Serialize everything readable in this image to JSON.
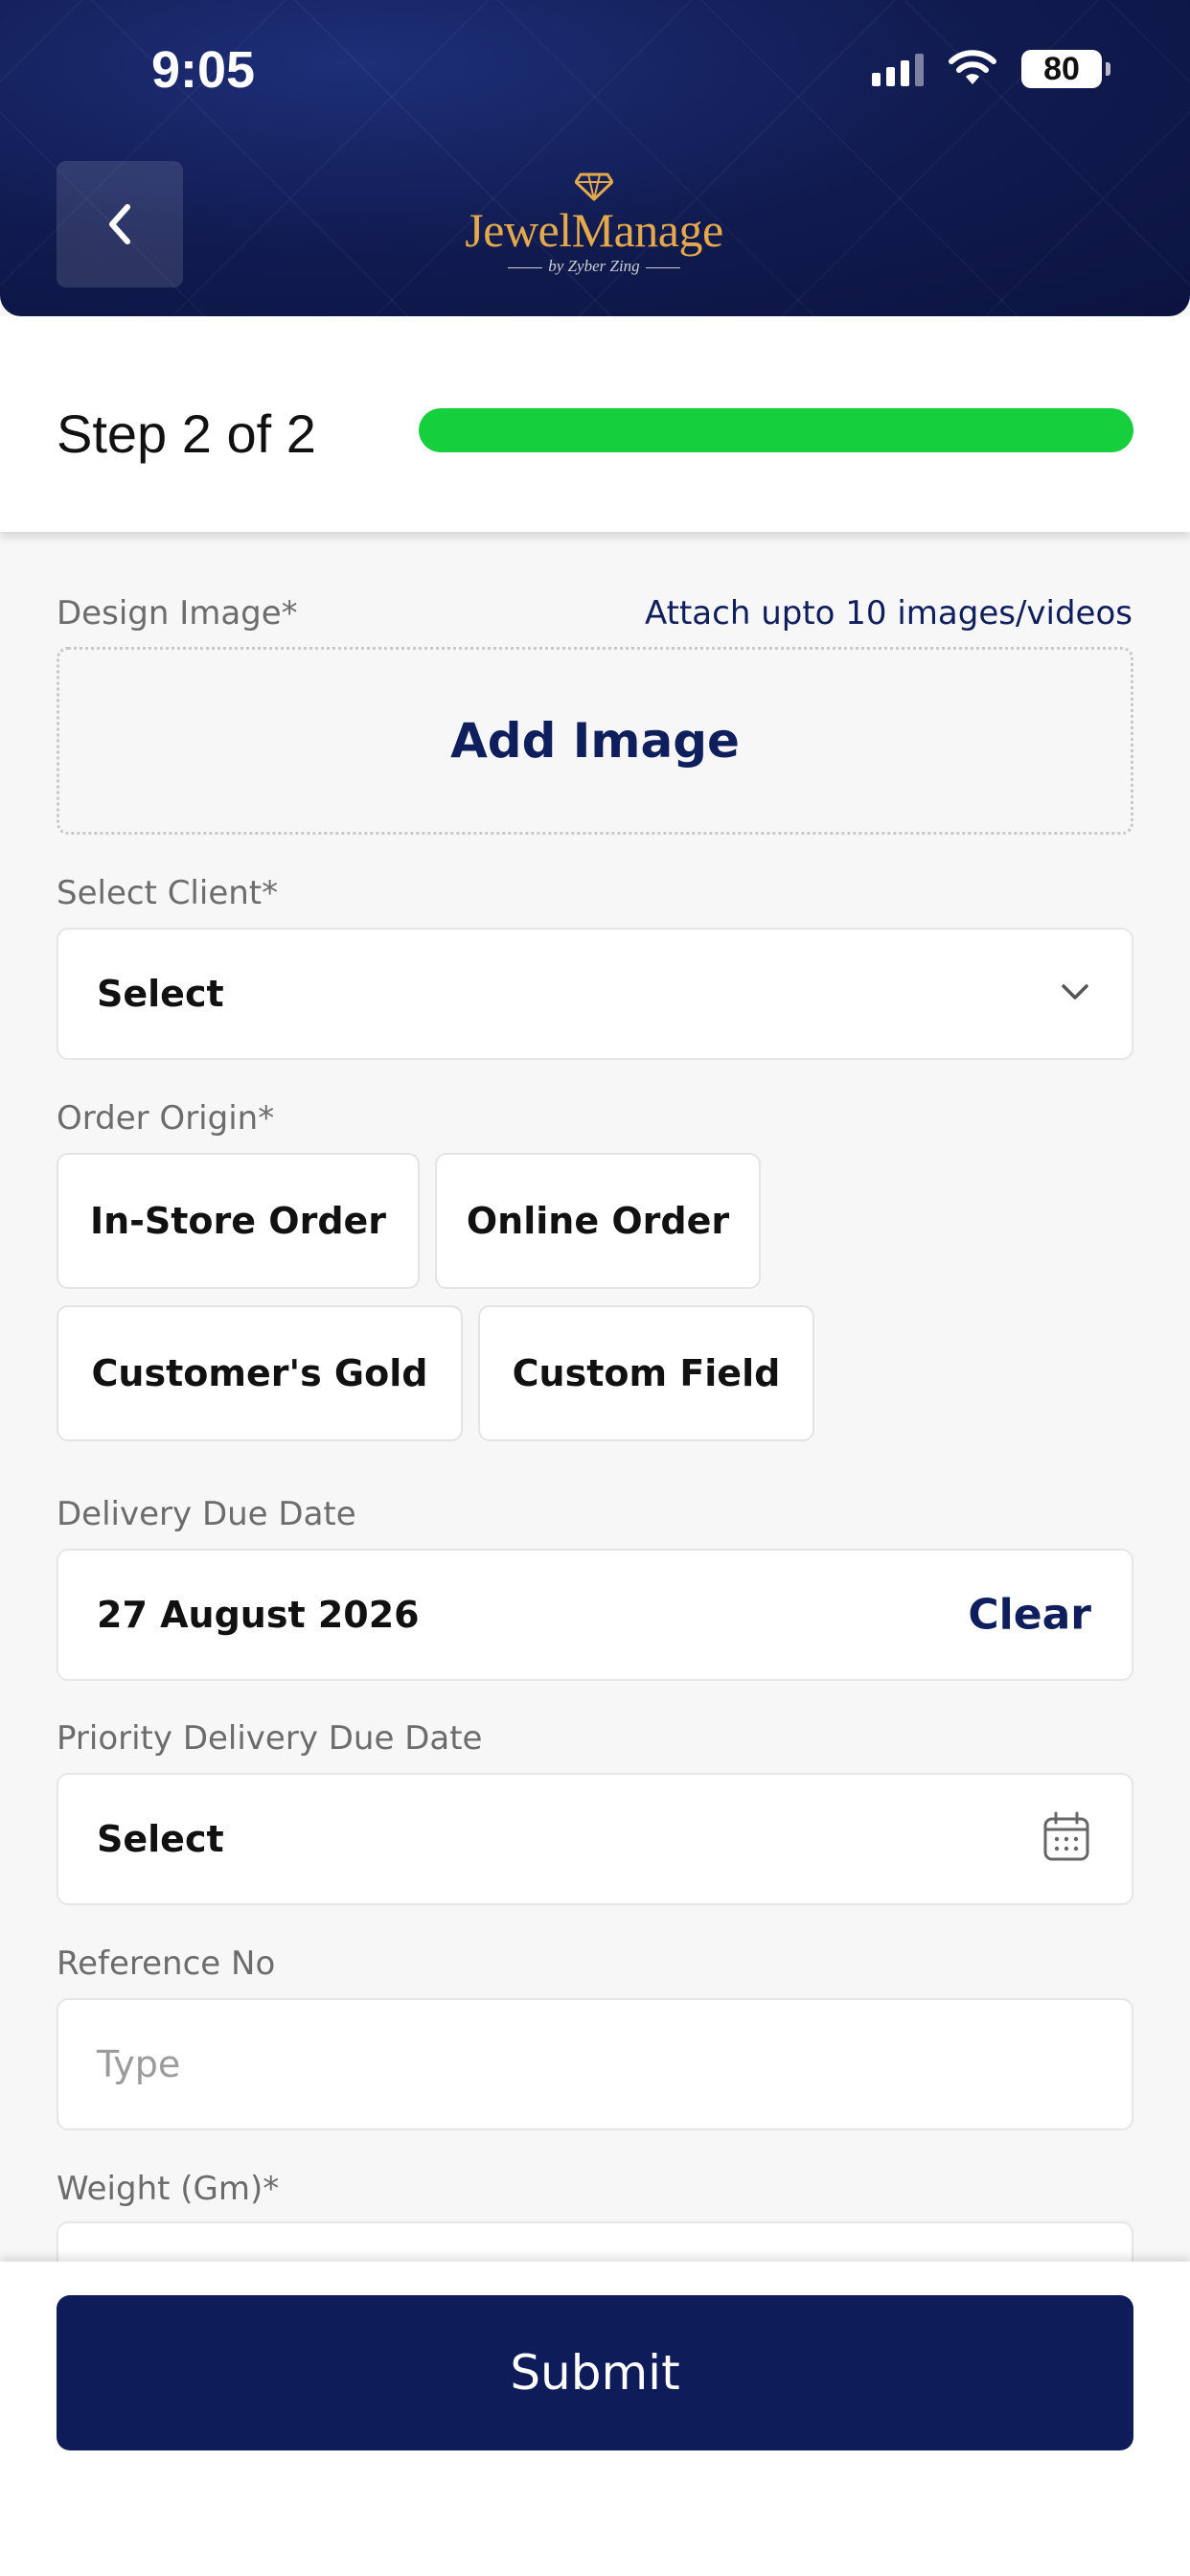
{
  "status_bar": {
    "time": "9:05",
    "battery": "80"
  },
  "header": {
    "logo_main": "JewelManage",
    "logo_sub": "by Zyber Zing"
  },
  "step": {
    "label": "Step 2 of 2",
    "progress": 1.0
  },
  "form": {
    "design_image": {
      "label": "Design Image*",
      "hint": "Attach upto 10 images/videos",
      "button": "Add Image"
    },
    "client": {
      "label": "Select Client*",
      "value": "Select"
    },
    "order_origin": {
      "label": "Order Origin*",
      "options": [
        "In-Store Order",
        "Online Order",
        "Customer's Gold",
        "Custom Field"
      ]
    },
    "delivery_due_date": {
      "label": "Delivery Due Date",
      "value": "27 August 2026",
      "clear": "Clear"
    },
    "priority_delivery_due_date": {
      "label": "Priority Delivery Due Date",
      "value": "Select"
    },
    "reference_no": {
      "label": "Reference No",
      "placeholder": "Type"
    },
    "weight": {
      "label": "Weight (Gm)*"
    }
  },
  "footer": {
    "submit": "Submit"
  },
  "colors": {
    "navy": "#0f1c5a",
    "progress": "#15cf3c",
    "gold": "#e3a94a"
  },
  "icons": [
    "signal-icon",
    "wifi-icon",
    "battery-icon",
    "back-chevron-icon",
    "diamond-icon",
    "chevron-down-icon",
    "calendar-icon"
  ]
}
